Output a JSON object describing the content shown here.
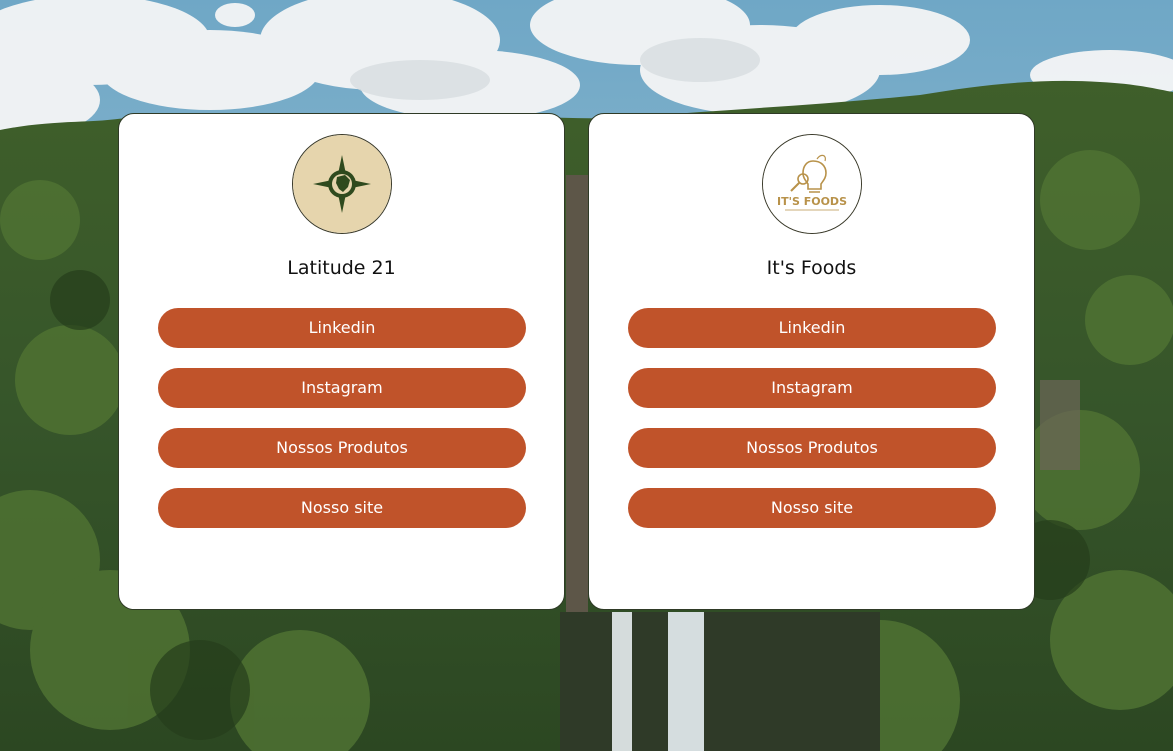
{
  "colors": {
    "button_bg": "#c0532a",
    "button_text": "#ffffff",
    "card_bg": "#ffffff",
    "logo_latitude_bg": "#e6d5ad",
    "logo_latitude_fg": "#2f4a1e"
  },
  "background": {
    "scene": "waterfall-forest-sky"
  },
  "cards": [
    {
      "title": "Latitude 21",
      "logo_icon": "compass-brazil-map-icon",
      "buttons": [
        {
          "label": "Linkedin"
        },
        {
          "label": "Instagram"
        },
        {
          "label": "Nossos Produtos"
        },
        {
          "label": "Nosso site"
        }
      ]
    },
    {
      "title": "It's Foods",
      "logo_icon": "lightbulb-magnifier-icon",
      "logo_text": "IT'S FOODS",
      "buttons": [
        {
          "label": "Linkedin"
        },
        {
          "label": "Instagram"
        },
        {
          "label": "Nossos Produtos"
        },
        {
          "label": "Nosso site"
        }
      ]
    }
  ]
}
